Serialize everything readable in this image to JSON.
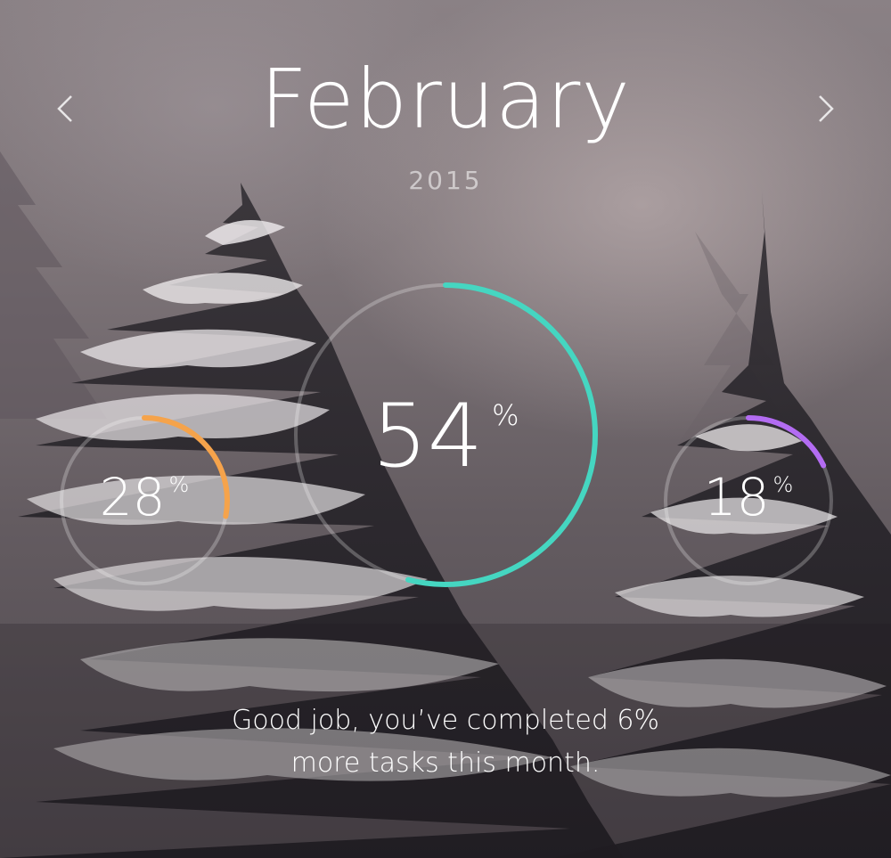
{
  "header": {
    "month": "February",
    "year": "2015",
    "prev_icon": "chevron-left-icon",
    "next_icon": "chevron-right-icon"
  },
  "rings": [
    {
      "id": "left",
      "value": 28,
      "label": "28",
      "percent_sign": "%",
      "color": "#f5a34b"
    },
    {
      "id": "center",
      "value": 54,
      "label": "54",
      "percent_sign": "%",
      "color": "#45d6c1"
    },
    {
      "id": "right",
      "value": 18,
      "label": "18",
      "percent_sign": "%",
      "color": "#b36cf2"
    }
  ],
  "message": {
    "line1": "Good job, you’ve completed 6%",
    "line2": "more tasks this month."
  },
  "colors": {
    "track": "#ffffff",
    "text": "#ffffff"
  }
}
